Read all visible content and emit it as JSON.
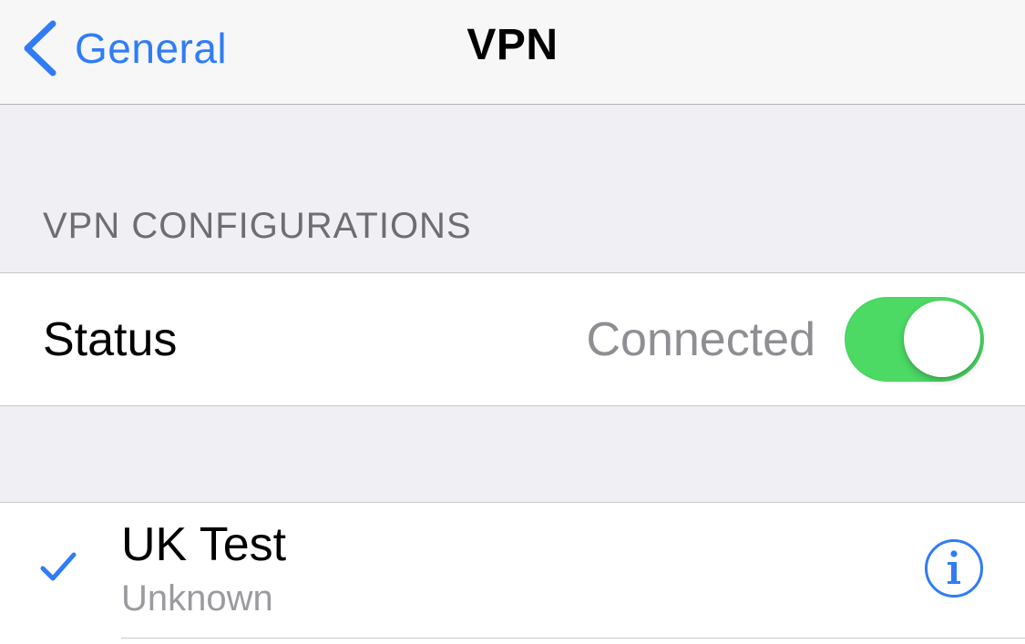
{
  "navbar": {
    "back_label": "General",
    "title": "VPN"
  },
  "section": {
    "header": "VPN CONFIGURATIONS"
  },
  "status": {
    "label": "Status",
    "value": "Connected",
    "toggle_on": true
  },
  "configurations": [
    {
      "name": "UK Test",
      "status": "Unknown",
      "selected": true
    }
  ],
  "colors": {
    "accent": "#2f7cf6",
    "toggle_on": "#4cd964",
    "background": "#efeff4",
    "secondary_text": "#8e8e93"
  },
  "icons": {
    "back": "chevron-left-icon",
    "selected": "checkmark-icon",
    "info": "info-icon"
  }
}
